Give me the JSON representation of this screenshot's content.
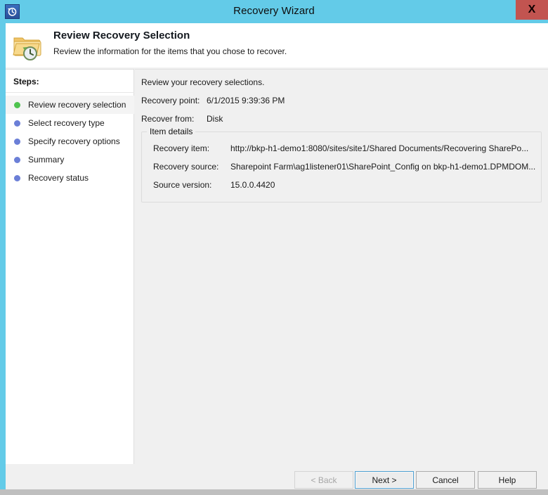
{
  "window": {
    "title": "Recovery Wizard",
    "titlebar_color": "#63cbe8",
    "close_label": "X",
    "app_icon": "recovery-clock-icon"
  },
  "header": {
    "icon": "folder-history-icon",
    "title": "Review Recovery Selection",
    "subtitle": "Review the information for the items that you chose to recover."
  },
  "sidebar": {
    "heading": "Steps:",
    "current_bullet_color": "#4fc34f",
    "pending_bullet_color": "#6b7fd7",
    "items": [
      {
        "label": "Review recovery selection",
        "state": "current"
      },
      {
        "label": "Select recovery type",
        "state": "pending"
      },
      {
        "label": "Specify recovery options",
        "state": "pending"
      },
      {
        "label": "Summary",
        "state": "pending"
      },
      {
        "label": "Recovery status",
        "state": "pending"
      }
    ]
  },
  "main": {
    "intro": "Review your recovery selections.",
    "fields": [
      {
        "key": "Recovery point:",
        "value": "6/1/2015 9:39:36 PM"
      },
      {
        "key": "Recover from:",
        "value": "Disk"
      }
    ],
    "group": {
      "legend": "Item details",
      "rows": [
        {
          "key": "Recovery item:",
          "value": "http://bkp-h1-demo1:8080/sites/site1/Shared Documents/Recovering SharePo..."
        },
        {
          "key": "Recovery source:",
          "value": "Sharepoint Farm\\ag1listener01\\SharePoint_Config on bkp-h1-demo1.DPMDOM..."
        },
        {
          "key": "Source version:",
          "value": "15.0.0.4420"
        }
      ]
    }
  },
  "footer": {
    "back_label": "< Back",
    "next_label": "Next >",
    "cancel_label": "Cancel",
    "help_label": "Help"
  }
}
